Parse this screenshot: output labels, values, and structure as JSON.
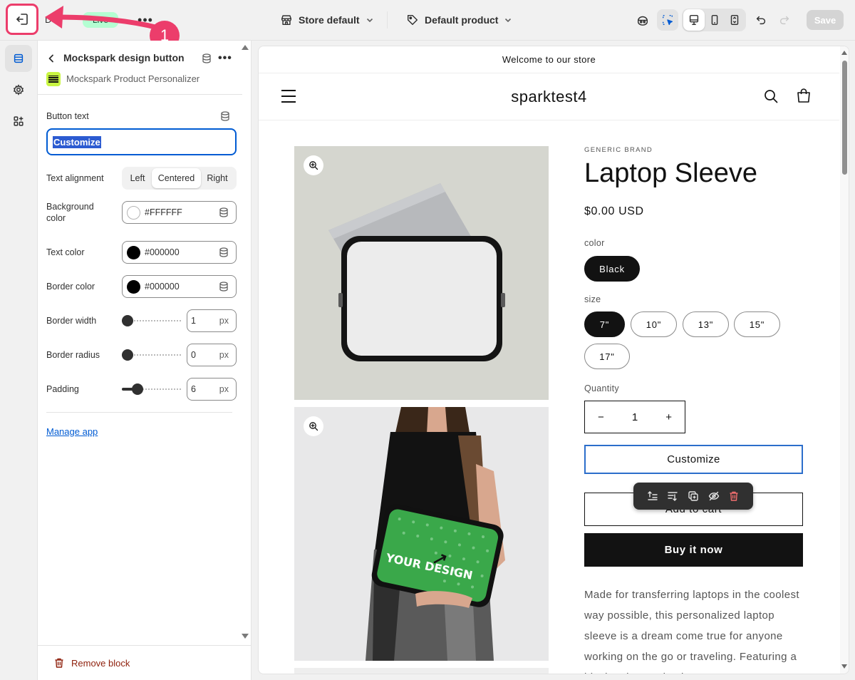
{
  "topbar": {
    "theme_name": "D",
    "status_badge": "Live",
    "more_label": "•••",
    "step_number": "1",
    "store_select": "Store default",
    "template_select": "Default product",
    "save_label": "Save"
  },
  "panel": {
    "block_title": "Mockspark design button",
    "app_name": "Mockspark Product Personalizer",
    "more_label": "•••",
    "button_text": {
      "label": "Button text",
      "value": "Customize"
    },
    "alignment": {
      "label": "Text alignment",
      "options": [
        "Left",
        "Centered",
        "Right"
      ],
      "selected": "Centered"
    },
    "background_color": {
      "label": "Background color",
      "value": "#FFFFFF"
    },
    "text_color": {
      "label": "Text color",
      "value": "#000000"
    },
    "border_color": {
      "label": "Border color",
      "value": "#000000"
    },
    "border_width": {
      "label": "Border width",
      "value": "1",
      "unit": "px",
      "fraction": 0.0
    },
    "border_radius": {
      "label": "Border radius",
      "value": "0",
      "unit": "px",
      "fraction": 0.0
    },
    "padding": {
      "label": "Padding",
      "value": "6",
      "unit": "px",
      "fraction": 0.2
    },
    "manage_link": "Manage app",
    "remove_label": "Remove block"
  },
  "preview": {
    "announcement": "Welcome to our store",
    "store_name": "sparktest4",
    "vendor": "GENERIC BRAND",
    "title": "Laptop Sleeve",
    "price": "$0.00 USD",
    "color_label": "color",
    "colors": [
      "Black"
    ],
    "size_label": "size",
    "sizes": [
      "7\"",
      "10\"",
      "13\"",
      "15\"",
      "17\""
    ],
    "selected_size": "7\"",
    "quantity_label": "Quantity",
    "quantity": "1",
    "minus": "−",
    "plus": "+",
    "customize_label": "Customize",
    "add_to_cart_label": "Add to cart",
    "buy_now_label": "Buy it now",
    "description": "Made for transferring laptops in the coolest way possible, this personalized laptop sleeve is a dream come true for anyone working on the go or traveling. Featuring a black polyester back, a water-",
    "sleeve_print": "YOUR DESIGN"
  },
  "colors": {
    "accent": "#005bd3",
    "annotation": "#ec3d6b",
    "live_badge": "#b4fed2",
    "sleeve_green": "#3aa84a"
  }
}
